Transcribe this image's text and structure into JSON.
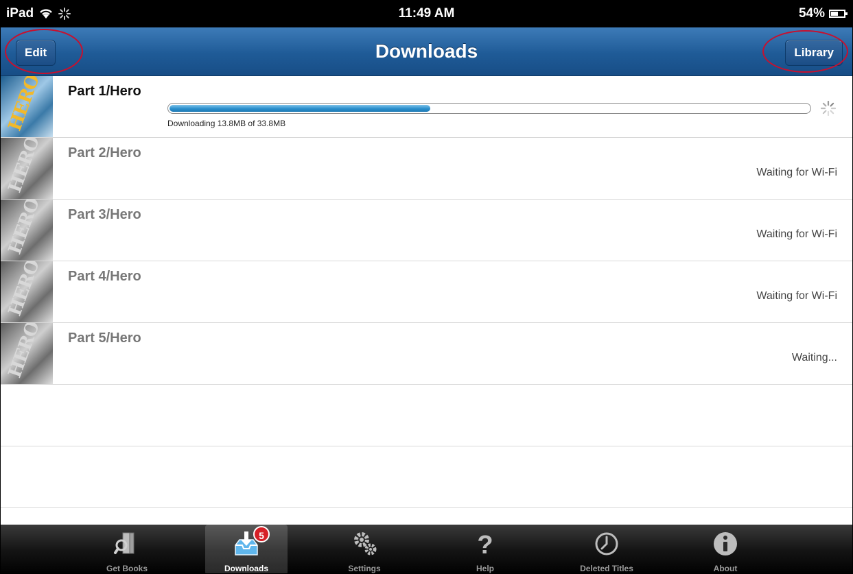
{
  "status_bar": {
    "device": "iPad",
    "time": "11:49 AM",
    "battery": "54%",
    "battery_level": 0.54
  },
  "nav": {
    "title": "Downloads",
    "edit_label": "Edit",
    "library_label": "Library"
  },
  "downloads": [
    {
      "title": "Part 1/Hero",
      "status": "Downloading 13.8MB of 33.8MB",
      "progress": 0.41,
      "active": true
    },
    {
      "title": "Part 2/Hero",
      "status": "Waiting for Wi-Fi"
    },
    {
      "title": "Part 3/Hero",
      "status": "Waiting for Wi-Fi"
    },
    {
      "title": "Part 4/Hero",
      "status": "Waiting for Wi-Fi"
    },
    {
      "title": "Part 5/Hero",
      "status": "Waiting..."
    }
  ],
  "tabs": [
    {
      "label": "Get Books",
      "icon": "books-icon"
    },
    {
      "label": "Downloads",
      "icon": "download-tray-icon",
      "badge": "5",
      "selected": true
    },
    {
      "label": "Settings",
      "icon": "gears-icon"
    },
    {
      "label": "Help",
      "icon": "question-mark-icon"
    },
    {
      "label": "Deleted Titles",
      "icon": "clock-icon"
    },
    {
      "label": "About",
      "icon": "info-icon"
    }
  ],
  "colors": {
    "nav_blue": "#1f5b97",
    "progress_blue": "#2a8fcc",
    "annotation_red": "#c8102e",
    "badge_red": "#d61f26"
  }
}
